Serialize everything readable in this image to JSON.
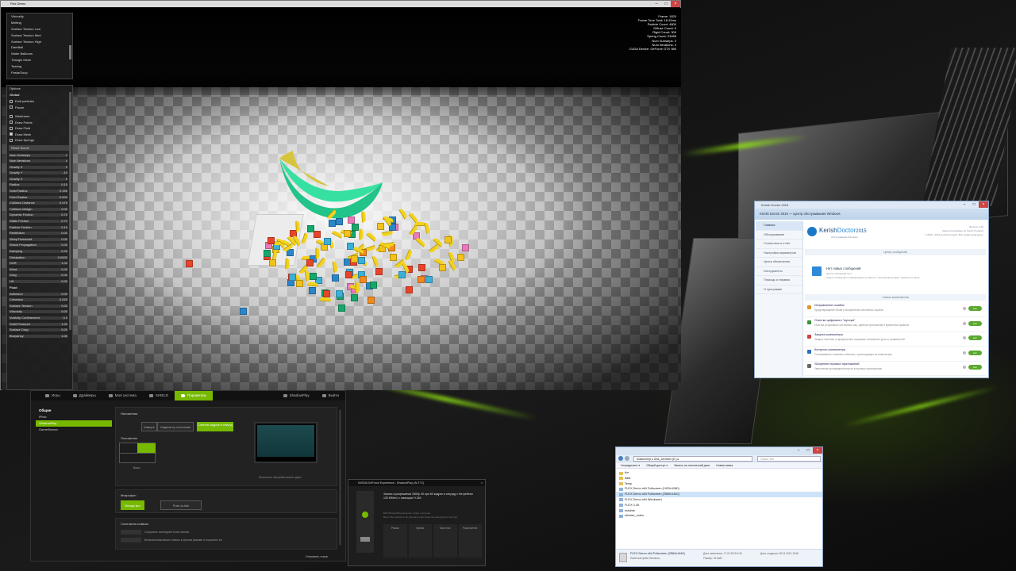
{
  "flex": {
    "window_title": "Flex Demo",
    "scene_list": [
      "Viscosity",
      "Melting",
      "Surface Tension Low",
      "Surface Tension Med",
      "Surface Tension High",
      "DamBall",
      "Water Balloons",
      "Triangle Mesh",
      "Tearing",
      "Pasta/Soup"
    ],
    "options_title": "Options",
    "global_label": "Global",
    "checks": [
      {
        "label": "Emit particles",
        "on": false
      },
      {
        "label": "Pause",
        "on": false
      },
      {
        "label": "Wireframe",
        "on": false
      },
      {
        "label": "Draw Points",
        "on": false
      },
      {
        "label": "Draw Fluid",
        "on": false
      },
      {
        "label": "Draw Mesh",
        "on": true
      },
      {
        "label": "Draw Springs",
        "on": false
      }
    ],
    "reset_label": "Reset Scene",
    "sliders_a": [
      {
        "label": "Num Substeps",
        "value": "2"
      },
      {
        "label": "Num Iterations",
        "value": "4"
      },
      {
        "label": "Gravity X",
        "value": "0"
      },
      {
        "label": "Gravity Y",
        "value": "-10"
      },
      {
        "label": "Gravity Z",
        "value": "0"
      },
      {
        "label": "Radius",
        "value": "0.15"
      },
      {
        "label": "Solid Radius",
        "value": "0.150"
      },
      {
        "label": "Fluid Radius",
        "value": "0.000"
      },
      {
        "label": "Collision Distance",
        "value": "0.075"
      },
      {
        "label": "Collision Margin",
        "value": "0.00"
      },
      {
        "label": "Dynamic Friction",
        "value": "0.70"
      },
      {
        "label": "Static Friction",
        "value": "0.70"
      },
      {
        "label": "Particle Friction",
        "value": "0.10"
      },
      {
        "label": "Restitution",
        "value": "0.00"
      },
      {
        "label": "SleepThreshold",
        "value": "0.00"
      },
      {
        "label": "Shock Propagation",
        "value": "0.00"
      },
      {
        "label": "Damping",
        "value": "0.25"
      },
      {
        "label": "Dissipation",
        "value": "0.0000"
      },
      {
        "label": "SOR",
        "value": "1.00"
      },
      {
        "label": "Wind",
        "value": "0.00"
      },
      {
        "label": "Drag",
        "value": "0.00"
      },
      {
        "label": "Lift",
        "value": "0.00"
      }
    ],
    "fluid_label": "Fluid",
    "sliders_b": [
      {
        "label": "Adhesion",
        "value": "0.00"
      },
      {
        "label": "Cohesion",
        "value": "0.025"
      },
      {
        "label": "Surface Tension",
        "value": "0.00"
      },
      {
        "label": "Viscosity",
        "value": "0.00"
      },
      {
        "label": "Vorticity Confinement",
        "value": "0.0"
      },
      {
        "label": "Solid Pressure",
        "value": "1.00"
      },
      {
        "label": "Surface Drag",
        "value": "0.00"
      },
      {
        "label": "Buoyancy",
        "value": "1.00"
      }
    ],
    "hud": [
      "Frame: 1820",
      "Frame Time Total: 16.52ms",
      "Particle Count: 4800",
      "Diffuse Count: 0",
      "Rigid Count: 300",
      "Spring Count: 23485",
      "Num Substeps: 2",
      "Num Iterations: 4",
      "CUDA Device: GeForce GTX 980"
    ]
  },
  "gfe": {
    "tabs": [
      "Игры",
      "Драйверы",
      "Моя система",
      "SHIELD",
      "Параметры"
    ],
    "right_tabs": [
      "ShadowPlay",
      "Выйти"
    ],
    "side_head": "Общие",
    "side_items": [
      "iPlew",
      "ShadowPlay",
      "GameStream"
    ],
    "overlay_title": "Наложения",
    "overlay_buttons": [
      "Камера",
      "Индикатор состояния",
      "Счетчик кадров в секунду"
    ],
    "position_title": "Положение",
    "position_caption": "Выкл",
    "preview_caption": "Выполнить настройки можно здесь",
    "mic_title": "Микрофон",
    "mic_buttons": [
      "Всегда вкл",
      "Push-to-talk"
    ],
    "hotkeys_title": "Сочетания клавиш",
    "hotkeys": [
      "Сохранить последние 5 мин записи",
      "Включить/выключить запись в ручном режиме и сохранить её"
    ],
    "footer_link": "Отправить отзыв"
  },
  "shadowplay": {
    "title": "NVIDIA GeForce Experience - ShadowPlay (ALT+Z)",
    "lines": [
      "Запись в разрешении 2560p 4K при 60 кадрах в секунду с битрейтом",
      "130 Мбит/с с помощью H.264"
    ],
    "notes": [
      "ВКЛ ShadowPlay включён, Fraps отключён",
      "Выкл При записи в 4K дисковое пространство расходуется быстро"
    ],
    "modes": [
      "Режим",
      "Время",
      "Качество",
      "Разрешение"
    ]
  },
  "kerish": {
    "window_title": "Kerish Doctor 2015",
    "app_header": "Kerish Doctor 2015 — Центр обслуживания Windows",
    "logo_a": "Kerish",
    "logo_b": "Doctor",
    "logo_year": "2015",
    "logo_sub": "Обслуживание Windows",
    "version_lines": [
      "Версия: 4.60",
      "Зарегистрировано на Kerish Products",
      "© 2005—2015 Kerish Products. Все права защищены."
    ],
    "nav": [
      "Главная",
      "Обслуживание",
      "Статистика и отчёт",
      "Настройка параметров",
      "Центр обновления",
      "Инструменты",
      "Помощь и справка",
      "О программе"
    ],
    "msg_section": "Центр сообщений",
    "msg_title": "Нет новых сообщений",
    "msg_desc": [
      "Центр сообщений пуст",
      "Новые сообщения и информация по работе с приложением будут появляться здесь."
    ],
    "components_section": "Список компонентов",
    "components": [
      {
        "title": "Исправление ошибок",
        "desc": "Предотвращение сбоев и исправление системных ошибок",
        "color": "#d89a2c",
        "toggle": "вкл"
      },
      {
        "title": "Очистка цифрового \"мусора\"",
        "desc": "Очистка устаревших системных кэш, файлов приложений и временных файлов",
        "color": "#3a8f3a",
        "toggle": "вкл"
      },
      {
        "title": "Защита компьютера",
        "desc": "Защита системы от вредоносных программ, вложенных угроз и уязвимостей",
        "color": "#c44",
        "toggle": "вкл"
      },
      {
        "title": "Контроль компьютера",
        "desc": "Отслеживание и важных событиях, происходящих на компьютере",
        "color": "#2b6fc2",
        "toggle": "вкл"
      },
      {
        "title": "Ускорение игровых приложений",
        "desc": "Увеличение производительности в игровых приложениях",
        "color": "#666",
        "toggle": "вкл"
      }
    ]
  },
  "explorer": {
    "breadcrumb": "Компьютер ▸ Disk_Archives (E:) ▸",
    "search_placeholder": "Поиск: flex",
    "toolbar": [
      "Упорядочить ▾",
      "Общий доступ ▾",
      "Запись на оптический диск",
      "Новая папка"
    ],
    "items": [
      {
        "name": "bin",
        "type": "folder"
      },
      {
        "name": "data",
        "type": "folder"
      },
      {
        "name": "Temp",
        "type": "folder"
      },
      {
        "name": "FLEX Demo x64 Fullscreen (1920x1080)",
        "type": "file"
      },
      {
        "name": "FLEX Demo x64 Fullscreen (2560x1440)",
        "type": "file",
        "selected": true
      },
      {
        "name": "FLEX Demo x64 Windowed",
        "type": "file"
      },
      {
        "name": "FLEX 0.25",
        "type": "file"
      },
      {
        "name": "readme",
        "type": "file"
      },
      {
        "name": "release_notes",
        "type": "file"
      }
    ],
    "status_name": "FLEX Demo x64 Fullscreen (2560x1440)",
    "status_type": "Пакетный файл Windows",
    "status_modified": "Дата изменения: 17.03.2015 9:06",
    "status_size": "Размер: 33 байт",
    "status_created": "Дата создания: 08.04.2015 18:50"
  }
}
